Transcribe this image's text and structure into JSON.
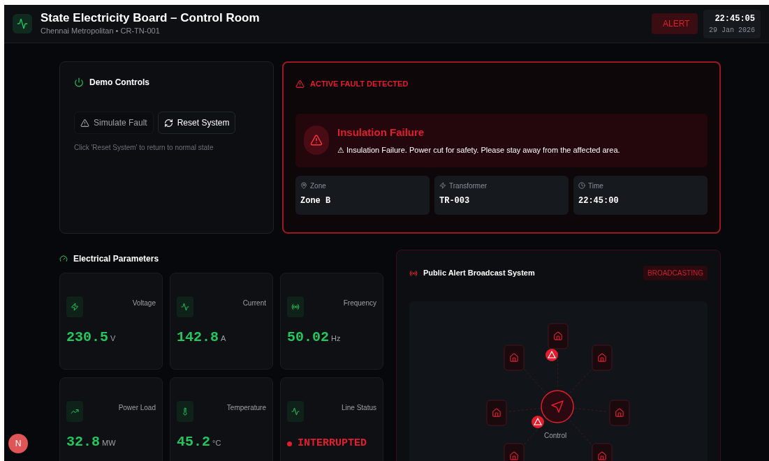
{
  "header": {
    "title": "State Electricity Board – Control Room",
    "subtitle": "Chennai Metropolitan • CR-TN-001",
    "alert_badge": "ALERT",
    "clock": {
      "time": "22:45:05",
      "date": "29 Jan 2026"
    }
  },
  "demo_controls": {
    "title": "Demo Controls",
    "buttons": [
      {
        "kind": "fault",
        "label": "Simulate Fault",
        "disabled": true
      },
      {
        "kind": "reset",
        "label": "Reset System",
        "disabled": false
      }
    ],
    "hint": "Click 'Reset System' to return to normal state"
  },
  "fault": {
    "heading": "ACTIVE FAULT DETECTED",
    "title": "Insulation Failure",
    "message": "⚠ Insulation Failure. Power cut for safety. Please stay away from the affected area.",
    "details": [
      {
        "kind": "zone",
        "label": "Zone",
        "value": "Zone B"
      },
      {
        "kind": "transformer",
        "label": "Transformer",
        "value": "TR-003"
      },
      {
        "kind": "time",
        "label": "Time",
        "value": "22:45:00"
      }
    ]
  },
  "parameters": {
    "title": "Electrical Parameters",
    "cards": [
      {
        "kind": "voltage",
        "label": "Voltage",
        "value": "230.5",
        "unit": "V"
      },
      {
        "kind": "current",
        "label": "Current",
        "value": "142.8",
        "unit": "A"
      },
      {
        "kind": "frequency",
        "label": "Frequency",
        "value": "50.02",
        "unit": "Hz"
      },
      {
        "kind": "load",
        "label": "Power Load",
        "value": "32.8",
        "unit": "MW"
      },
      {
        "kind": "temperature",
        "label": "Temperature",
        "value": "45.2",
        "unit": "°C"
      },
      {
        "kind": "status",
        "label": "Line Status",
        "value": "INTERRUPTED"
      }
    ]
  },
  "broadcast": {
    "title": "Public Alert Broadcast System",
    "badge": "BROADCASTING",
    "center_label": "Control"
  },
  "dev_indicator": "N"
}
